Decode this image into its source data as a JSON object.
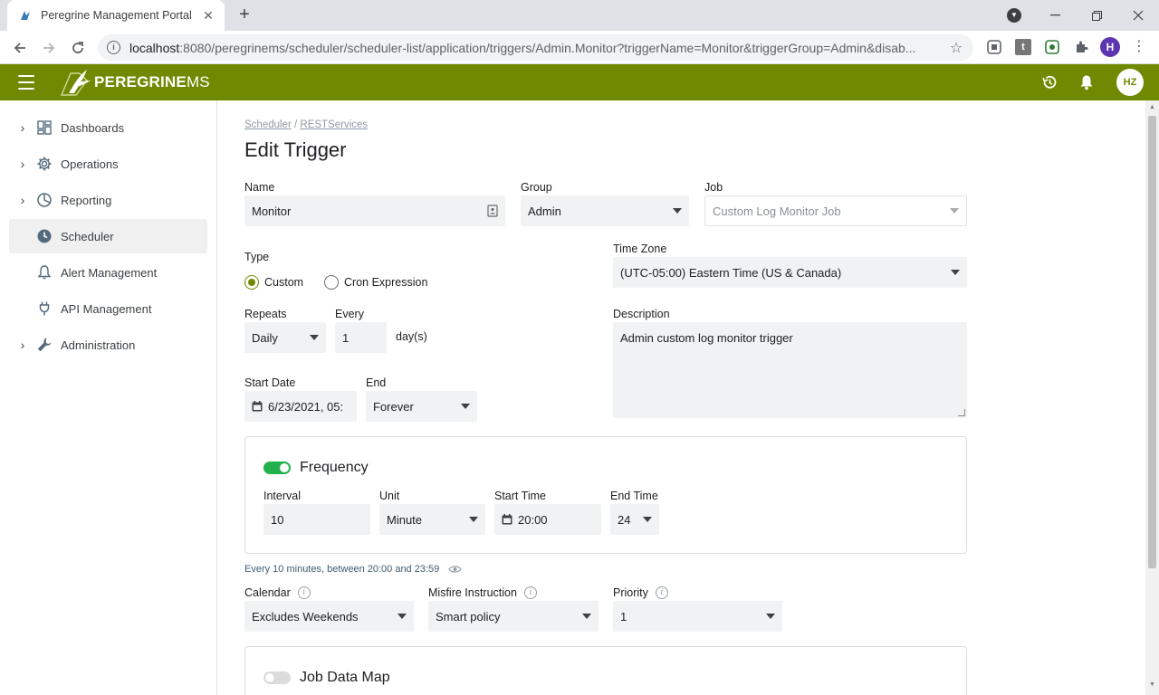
{
  "browser": {
    "tab_title": "Peregrine Management Portal",
    "url_host": "localhost",
    "url_rest": ":8080/peregrinems/scheduler/scheduler-list/application/triggers/Admin.Monitor?triggerName=Monitor&triggerGroup=Admin&disab...",
    "profile_initial": "H",
    "ext_t_label": "t"
  },
  "app": {
    "brand_bold": "PEREGRINE",
    "brand_thin": "MS",
    "user_initials": "HZ"
  },
  "sidebar": {
    "items": [
      {
        "label": "Dashboards",
        "icon": "dashboard-icon"
      },
      {
        "label": "Operations",
        "icon": "gear-icon"
      },
      {
        "label": "Reporting",
        "icon": "pie-chart-icon"
      },
      {
        "label": "Scheduler",
        "icon": "clock-icon"
      },
      {
        "label": "Alert Management",
        "icon": "bell-icon"
      },
      {
        "label": "API Management",
        "icon": "plug-icon"
      },
      {
        "label": "Administration",
        "icon": "wrench-icon"
      }
    ]
  },
  "breadcrumb": {
    "root": "Scheduler",
    "sep": "/",
    "current": "RESTServices"
  },
  "page": {
    "title": "Edit Trigger"
  },
  "form": {
    "name_label": "Name",
    "name_value": "Monitor",
    "group_label": "Group",
    "group_value": "Admin",
    "job_label": "Job",
    "job_value": "Custom Log Monitor Job",
    "type_label": "Type",
    "type_custom": "Custom",
    "type_cron": "Cron Expression",
    "timezone_label": "Time Zone",
    "timezone_value": "(UTC-05:00) Eastern Time (US & Canada)",
    "repeats_label": "Repeats",
    "repeats_value": "Daily",
    "every_label": "Every",
    "every_value": "1",
    "every_unit": "day(s)",
    "description_label": "Description",
    "description_value": "Admin custom log monitor trigger",
    "start_date_label": "Start Date",
    "start_date_value": "6/23/2021, 05:",
    "end_label": "End",
    "end_value": "Forever"
  },
  "frequency": {
    "title": "Frequency",
    "interval_label": "Interval",
    "interval_value": "10",
    "unit_label": "Unit",
    "unit_value": "Minute",
    "start_time_label": "Start Time",
    "start_time_value": "20:00",
    "end_time_label": "End Time",
    "end_time_value": "24",
    "summary": "Every 10 minutes, between 20:00 and 23:59"
  },
  "options": {
    "calendar_label": "Calendar",
    "calendar_value": "Excludes Weekends",
    "misfire_label": "Misfire Instruction",
    "misfire_value": "Smart policy",
    "priority_label": "Priority",
    "priority_value": "1"
  },
  "job_data_map": {
    "title": "Job Data Map"
  },
  "colors": {
    "brand": "#6f8a00",
    "toggle_on": "#22b14c",
    "summary_text": "#3d5c73"
  }
}
